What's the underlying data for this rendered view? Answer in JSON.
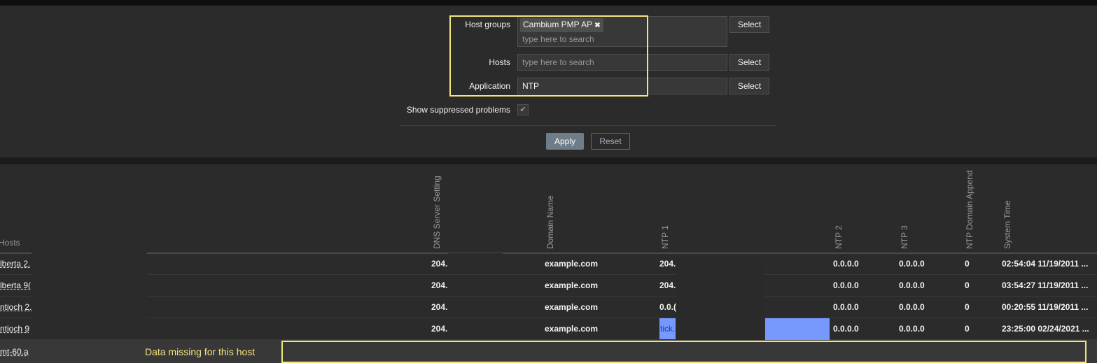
{
  "filter": {
    "host_groups_label": "Host groups",
    "host_group_tag": "Cambium PMP AP",
    "remove_icon": "✖",
    "search_placeholder": "type here to search",
    "hosts_label": "Hosts",
    "application_label": "Application",
    "application_value": "NTP",
    "select_label": "Select",
    "suppressed_label": "Show suppressed problems",
    "check_icon": "✔",
    "apply_label": "Apply",
    "reset_label": "Reset"
  },
  "table": {
    "columns": [
      "Hosts",
      "DNS Server Setting",
      "Domain Name",
      "NTP 1",
      "NTP 2",
      "NTP 3",
      "NTP Domain Append",
      "System Time"
    ],
    "rows": [
      {
        "host": "lberta 2.",
        "dns": "204.",
        "domain": "example.com",
        "ntp1": "204.",
        "ntp2": "0.0.0.0",
        "ntp3": "0.0.0.0",
        "append": "0",
        "time": "02:54:04 11/19/2011 ..."
      },
      {
        "host": "lberta 9(",
        "dns": "204.",
        "domain": "example.com",
        "ntp1": "204.",
        "ntp2": "0.0.0.0",
        "ntp3": "0.0.0.0",
        "append": "0",
        "time": "03:54:27 11/19/2011 ..."
      },
      {
        "host": "ntioch 2.",
        "dns": "204.",
        "domain": "example.com",
        "ntp1": "0.0.(",
        "ntp2": "0.0.0.0",
        "ntp3": "0.0.0.0",
        "append": "0",
        "time": "00:20:55 11/19/2011 ..."
      },
      {
        "host": "ntioch 9",
        "dns": "204.",
        "domain": "example.com",
        "ntp1": "tick.",
        "ntp2": "0.0.0.0",
        "ntp3": "0.0.0.0",
        "append": "0",
        "time": "23:25:00 02/24/2021 ..."
      }
    ],
    "missing_row": {
      "host": "mt-60.a",
      "annotation": "Data missing for this host"
    }
  }
}
